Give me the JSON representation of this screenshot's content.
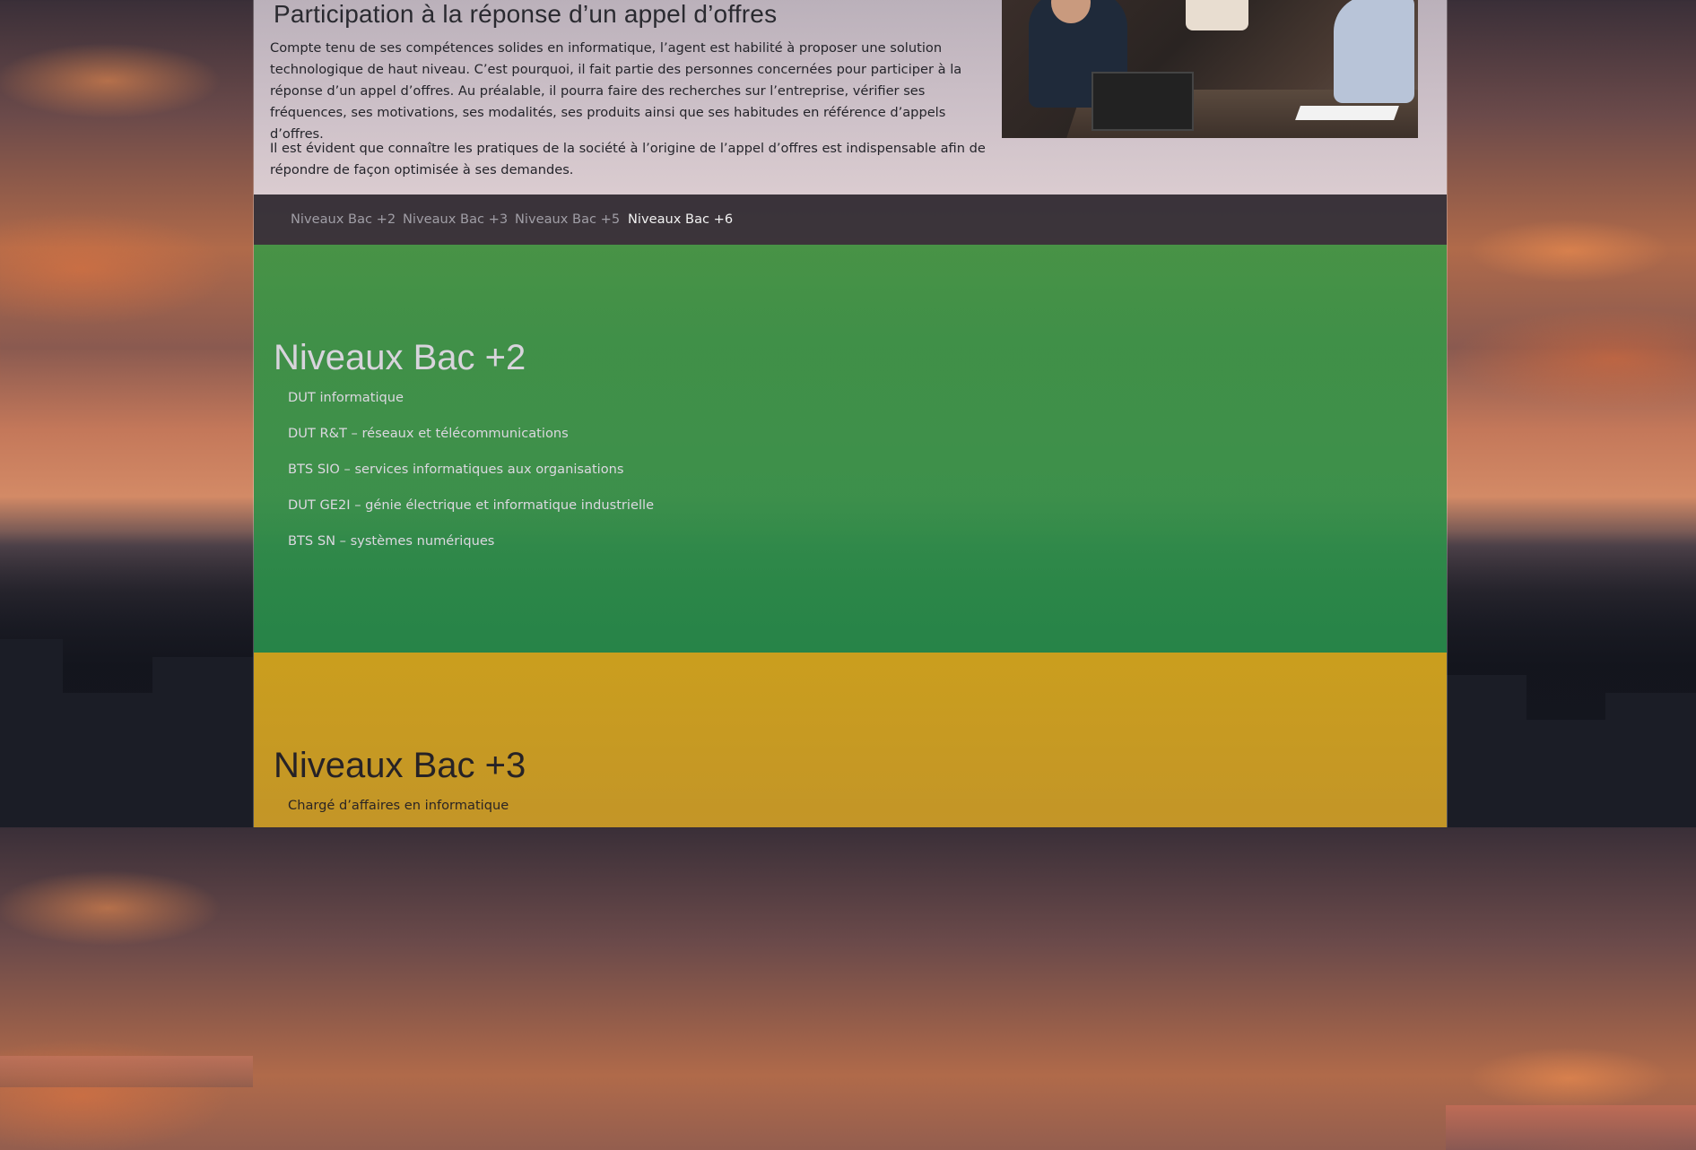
{
  "intro": {
    "title": "Participation à la réponse d’un appel d’offres",
    "paragraph1": "Compte tenu de ses compétences solides en informatique, l’agent est habilité à proposer une solution technologique de haut niveau. C’est pourquoi, il fait partie des personnes concernées pour participer à la réponse d’un appel d’offres. Au préalable, il pourra faire des recherches sur l’entreprise, vérifier ses fréquences, ses motivations, ses modalités, ses produits ainsi que ses habitudes en référence d’appels d’offres.",
    "paragraph2": "Il est évident que connaître les pratiques de la société à l’origine de l’appel d’offres est indispensable afin de répondre de façon optimisée à ses demandes."
  },
  "nav": {
    "items": [
      {
        "label": "Niveaux Bac +2",
        "active": false
      },
      {
        "label": "Niveaux Bac +3",
        "active": false
      },
      {
        "label": "Niveaux Bac +5",
        "active": false
      },
      {
        "label": "Niveaux Bac +6",
        "active": true
      }
    ]
  },
  "sections": [
    {
      "title": "Niveaux Bac +2",
      "color": "#3f9646",
      "items": [
        "DUT informatique",
        "DUT R&T – réseaux et télécommunications",
        "BTS SIO – services informatiques aux organisations",
        "DUT GE2I – génie électrique et informatique industrielle",
        "BTS SN – systèmes numériques"
      ]
    },
    {
      "title": "Niveaux Bac +3",
      "color": "#daaa1e",
      "items": [
        "Chargé d’affaires en informatique"
      ]
    }
  ]
}
